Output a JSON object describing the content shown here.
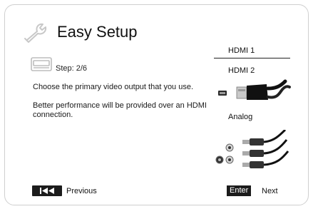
{
  "header": {
    "title": "Easy Setup",
    "icon": "wrench-icon"
  },
  "step": {
    "label": "Step: 2/6",
    "icon": "hdmi-port-icon"
  },
  "description": {
    "line1": "Choose the primary video output that you use.",
    "line2": "Better performance will be provided over an HDMI connection."
  },
  "options": [
    {
      "label": "HDMI 1",
      "selected": true
    },
    {
      "label": "HDMI 2",
      "selected": false
    },
    {
      "label": "Analog",
      "selected": false
    }
  ],
  "footer": {
    "previous": {
      "key_icon": "skip-back-icon",
      "label": "Previous"
    },
    "next": {
      "key": "Enter",
      "label": "Next"
    }
  },
  "colors": {
    "text": "#1a1a1a",
    "key_bg": "#1c1c1c",
    "key_text": "#ffffff",
    "frame_border": "#cfcfcf"
  }
}
